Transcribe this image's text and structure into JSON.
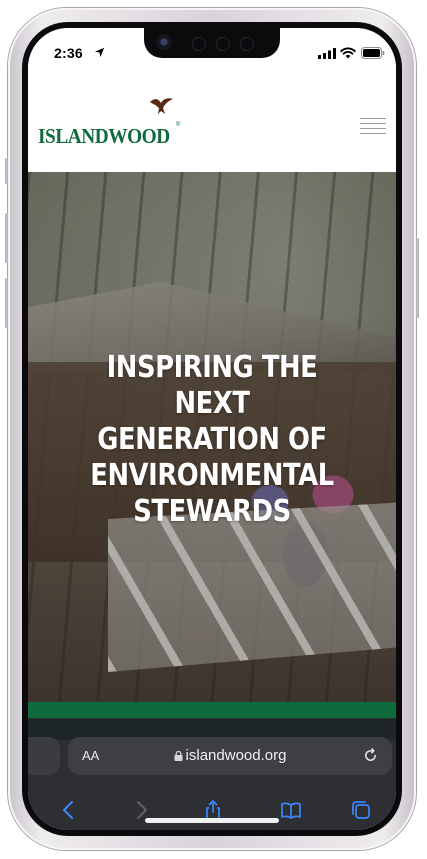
{
  "status_bar": {
    "time": "2:36",
    "icons": [
      "location-arrow-icon",
      "cellular-signal-icon",
      "wifi-icon",
      "battery-icon"
    ]
  },
  "site": {
    "logo_text": "ISLANDWOOD",
    "logo_trademark": "®",
    "brand_color": "#0f6a3c",
    "menu_icon": "hamburger-menu-icon"
  },
  "hero": {
    "heading_lines": [
      "INSPIRING THE",
      "NEXT",
      "GENERATION OF",
      "ENVIRONMENTAL",
      "STEWARDS"
    ]
  },
  "browser": {
    "text_size_label": "AA",
    "url": "islandwood.org",
    "toolbar": [
      "back-icon",
      "forward-icon",
      "share-icon",
      "bookmarks-icon",
      "tabs-icon"
    ]
  }
}
